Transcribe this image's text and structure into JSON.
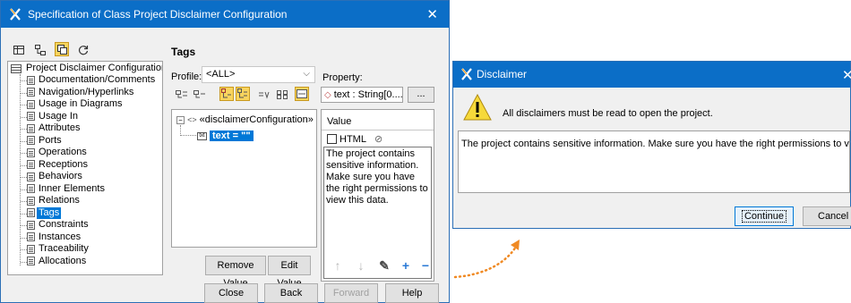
{
  "spec_dialog": {
    "title": "Specification of Class Project Disclaimer Configuration",
    "section_title": "Tags",
    "tree": {
      "root": "Project Disclaimer Configuration",
      "items": [
        "Documentation/Comments",
        "Navigation/Hyperlinks",
        "Usage in Diagrams",
        "Usage In",
        "Attributes",
        "Ports",
        "Operations",
        "Receptions",
        "Behaviors",
        "Inner Elements",
        "Relations",
        "Tags",
        "Constraints",
        "Instances",
        "Traceability",
        "Allocations"
      ],
      "selected": "Tags"
    },
    "profile_label": "Profile:",
    "profile_value": "<ALL>",
    "property_label": "Property:",
    "property_value": "text : String[0....",
    "property_more": "...",
    "tag_tree": {
      "stereotype": "«disclaimerConfiguration»",
      "selected_value": "text = \"\""
    },
    "value_label": "Value",
    "html_label": "HTML",
    "value_text": "The project contains sensitive information. Make sure you have the right permissions to view this data.",
    "remove_value": "Remove Value",
    "edit_value": "Edit Value",
    "buttons": {
      "close": "Close",
      "back": "Back",
      "forward": "Forward",
      "help": "Help"
    }
  },
  "disclaimer_dialog": {
    "title": "Disclaimer",
    "message": "All disclaimers must be read to open the project.",
    "text": "The project contains sensitive information. Make sure you have the right permissions to view this data.",
    "continue": "Continue",
    "cancel": "Cancel"
  },
  "colors": {
    "title_bar": "#0b6ec7",
    "selection": "#0078d7",
    "arrow": "#f08a24"
  }
}
